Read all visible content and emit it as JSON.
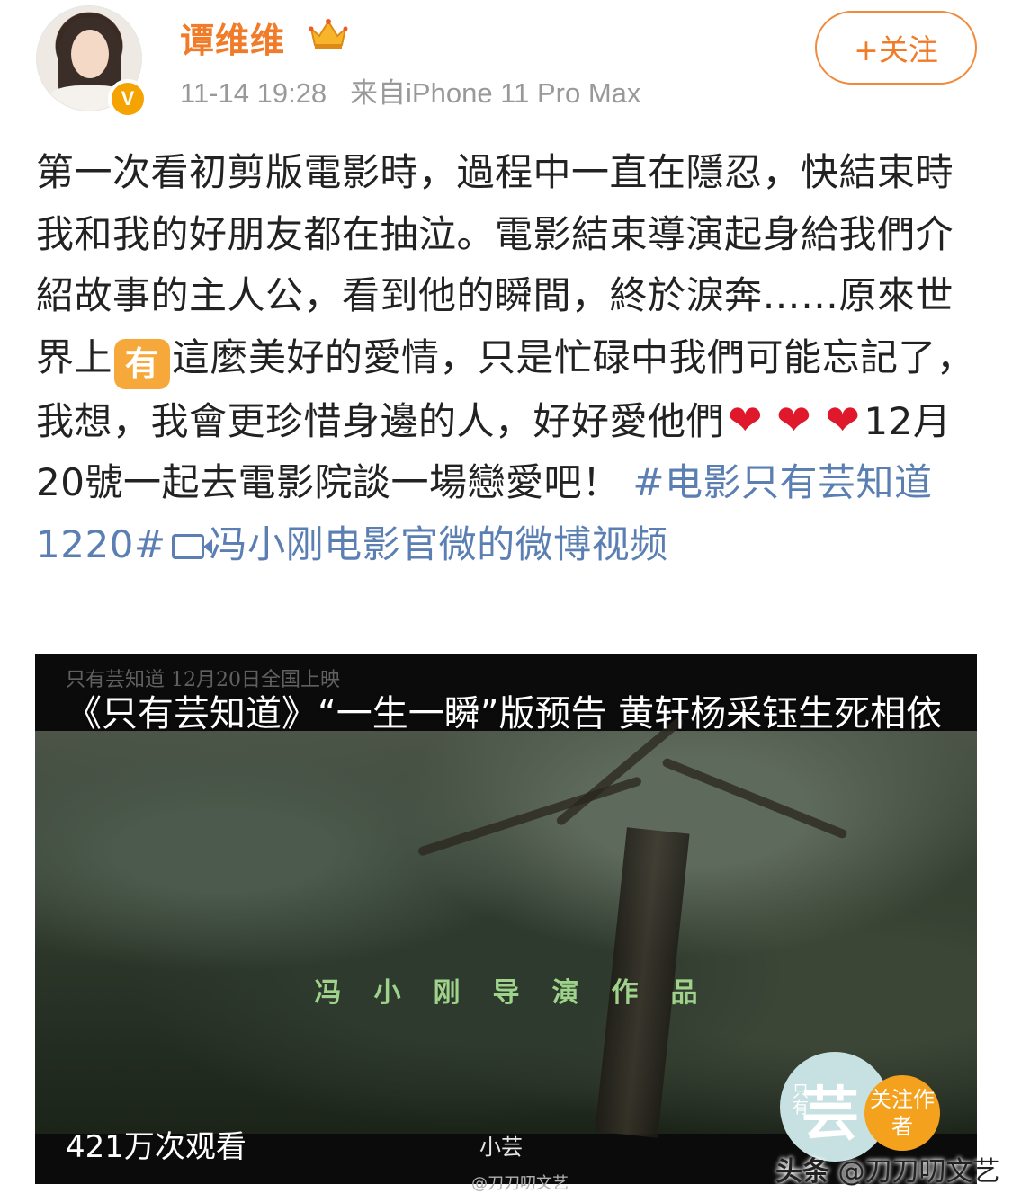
{
  "post": {
    "username": "谭维维",
    "verified_badge": "V",
    "timestamp": "11-14 19:28",
    "source": "来自iPhone 11 Pro Max",
    "follow_label": "+关注",
    "text": {
      "part1": "第一次看初剪版電影時，過程中一直在隱忍，快結束時我和我的好朋友都在抽泣。電影結束導演起身給我們介紹故事的主人公，看到他的瞬間，終於淚奔……原來世界上",
      "emoji_you": "有",
      "part2": "這麼美好的愛情，只是忙碌中我們可能忘記了，我想，我會更珍惜身邊的人，好好愛他們",
      "hearts": "❤ ❤ ❤",
      "part3": "12月20號一起去電影院談一場戀愛吧！",
      "hashtag": "#电影只有芸知道1220#",
      "video_link": "冯小刚电影官微的微博视频"
    }
  },
  "video": {
    "title": "《只有芸知道》“一生一瞬”版预告 黄轩杨采钰生死相依",
    "watermark_top": "只有芸知道 12月20日全国上映",
    "credit": "冯小刚导演作品",
    "view_count": "421万次观看",
    "channel": "小芸",
    "logo_glyph": "芸",
    "logo_side": "只有",
    "follow_author": "关注作者"
  },
  "footer": {
    "watermark_center": "@刀刀叨文艺",
    "watermark_brand": "头条",
    "watermark_handle": "@刀刀叨文艺"
  },
  "colors": {
    "username": "#f07c2a",
    "link": "#5b7fb3",
    "badge": "#f4a300",
    "heart": "#e0182b"
  },
  "icons": [
    "crown-icon",
    "verified-badge-icon",
    "video-link-icon",
    "heart-icon"
  ]
}
